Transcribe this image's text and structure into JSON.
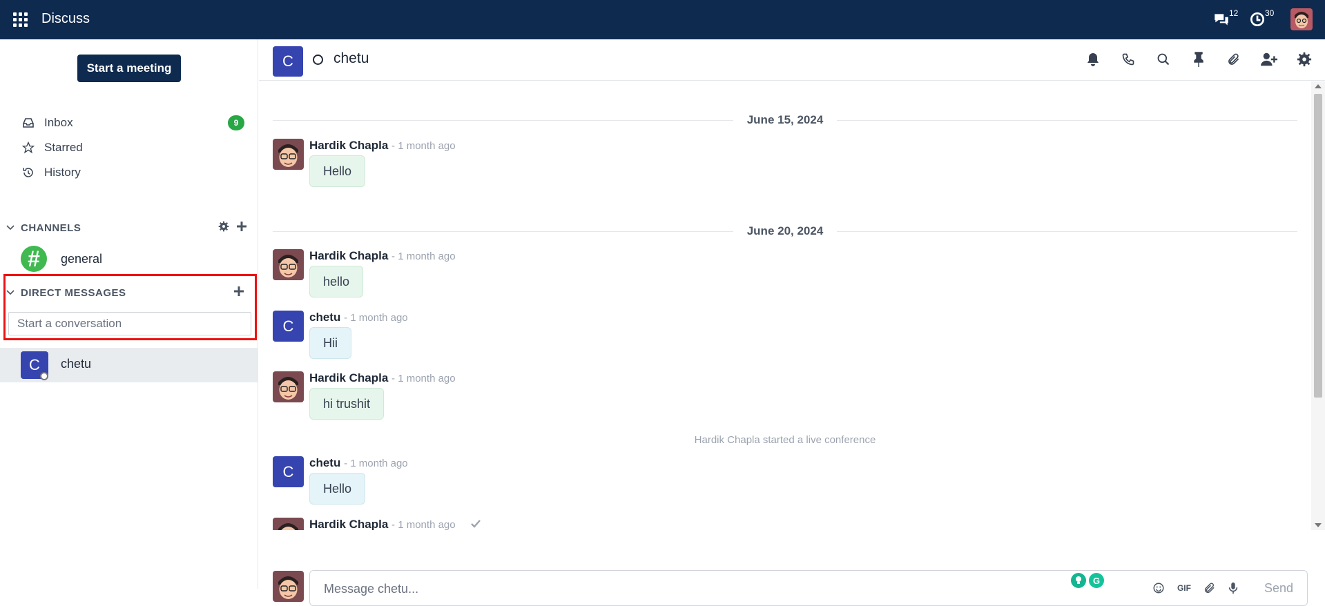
{
  "app": {
    "title": "Discuss"
  },
  "topbar": {
    "messages_count": "12",
    "activities_count": "30"
  },
  "sidebar": {
    "meeting_button": "Start a meeting",
    "nav": [
      {
        "label": "Inbox",
        "icon": "inbox-icon",
        "badge": "9"
      },
      {
        "label": "Starred",
        "icon": "star-icon"
      },
      {
        "label": "History",
        "icon": "history-icon"
      }
    ],
    "channels": {
      "heading": "CHANNELS",
      "items": [
        {
          "label": "general"
        }
      ]
    },
    "direct_messages": {
      "heading": "DIRECT MESSAGES",
      "search_placeholder": "Start a conversation",
      "items": [
        {
          "label": "chetu",
          "initial": "C"
        }
      ]
    }
  },
  "chat": {
    "header": {
      "initial": "C",
      "name": "chetu"
    },
    "dates": [
      "June 15, 2024",
      "June 20, 2024"
    ],
    "messages": [
      {
        "author": "Hardik Chapla",
        "time": "- 1 month ago",
        "text": "Hello"
      },
      {
        "author": "Hardik Chapla",
        "time": "- 1 month ago",
        "text": "hello"
      },
      {
        "author": "chetu",
        "time": "- 1 month ago",
        "text": "Hii",
        "initial": "C"
      },
      {
        "author": "Hardik Chapla",
        "time": "- 1 month ago",
        "text": "hi trushit"
      },
      {
        "author": "chetu",
        "time": "- 1 month ago",
        "text": "Hello",
        "initial": "C"
      },
      {
        "author": "Hardik Chapla",
        "time": "- 1 month ago"
      }
    ],
    "system_note": "Hardik Chapla started a live conference",
    "composer": {
      "placeholder": "Message chetu...",
      "gif_label": "GIF",
      "send_label": "Send"
    }
  },
  "colors": {
    "topbar": "#0e2a4f",
    "accent_avatar": "#3644b0",
    "badge_green": "#28a745",
    "highlight_red": "#e11111"
  }
}
